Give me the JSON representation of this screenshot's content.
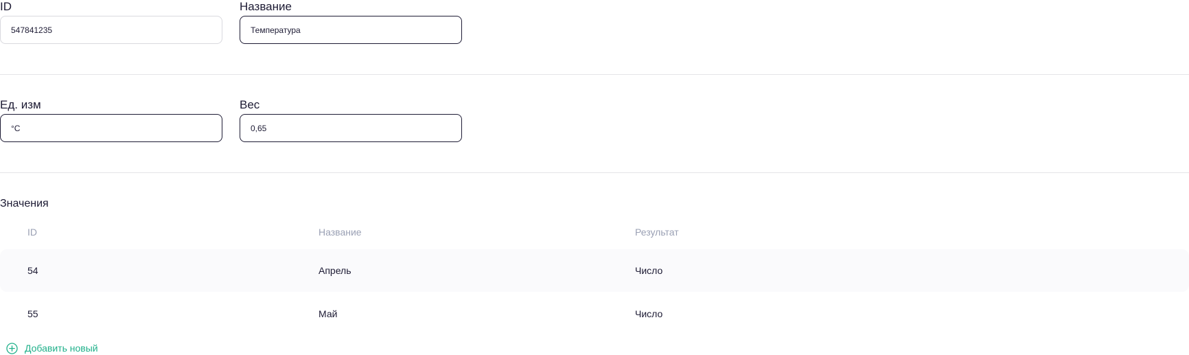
{
  "form": {
    "id_label": "ID",
    "id_value": "547841235",
    "name_label": "Название",
    "name_value": "Температура",
    "unit_label": "Ед. изм",
    "unit_value": "°С",
    "weight_label": "Вес",
    "weight_value": "0,65"
  },
  "values_section": {
    "title": "Значения",
    "columns": [
      "ID",
      "Название",
      "Результат"
    ],
    "rows": [
      {
        "id": "54",
        "name": "Апрель",
        "result": "Число"
      },
      {
        "id": "55",
        "name": "Май",
        "result": "Число"
      }
    ],
    "add_label": "Добавить новый",
    "add_icon": "plus-circle-icon"
  },
  "colors": {
    "text": "#1c1a33",
    "muted": "#9aa0b4",
    "accent": "#1fb08a",
    "border": "#1c1a33",
    "row_shade": "#fafafc"
  }
}
